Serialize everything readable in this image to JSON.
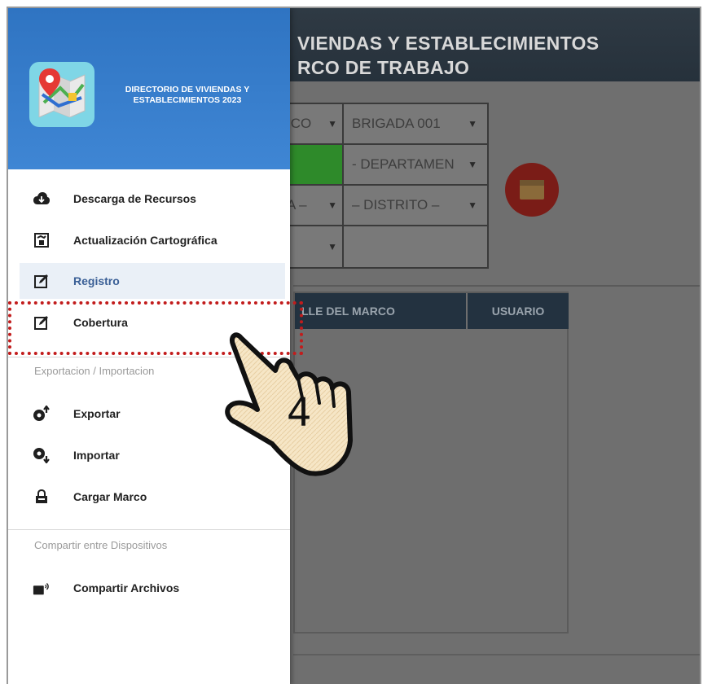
{
  "app": {
    "title_line1": "VIENDAS Y ESTABLECIMIENTOS",
    "title_line2": "RCO DE TRABAJO",
    "form": {
      "r1c1": "ICO",
      "r1c2": "BRIGADA 001",
      "r2c2": "- DEPARTAMEN",
      "r3c1": "A –",
      "r3c2": "– DISTRITO –"
    },
    "table": {
      "col1": "LLE DEL MARCO",
      "col2": "USUARIO"
    }
  },
  "drawer": {
    "brand_line1": "DIRECTORIO DE VIVIENDAS Y",
    "brand_line2": "ESTABLECIMIENTOS 2023",
    "items": [
      {
        "label": "Descarga de Recursos",
        "icon": "cloud-download-icon"
      },
      {
        "label": "Actualización Cartográfica",
        "icon": "map-edit-icon"
      },
      {
        "label": "Registro",
        "icon": "edit-icon"
      },
      {
        "label": "Cobertura",
        "icon": "edit-icon"
      }
    ],
    "section_export": "Exportacion / Importacion",
    "export_items": [
      {
        "label": "Exportar",
        "icon": "export-icon"
      },
      {
        "label": "Importar",
        "icon": "import-icon"
      },
      {
        "label": "Cargar Marco",
        "icon": "lock-icon"
      }
    ],
    "section_share": "Compartir entre Dispositivos",
    "share_items": [
      {
        "label": "Compartir Archivos",
        "icon": "share-files-icon"
      }
    ]
  },
  "annotation": {
    "step_number": "4",
    "highlight_color": "#c21c1c"
  },
  "colors": {
    "drawer_header": "#2f74c2",
    "active_item_bg": "#eaf0f7",
    "table_header": "#233240",
    "green_cell": "#2e8a2a"
  }
}
